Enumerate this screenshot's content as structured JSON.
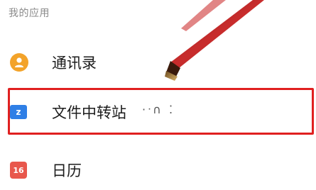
{
  "section": {
    "title": "我的应用"
  },
  "apps": [
    {
      "label": "通讯录",
      "icon": "contacts-icon",
      "icon_color": "#f3a32a"
    },
    {
      "label": "文件中转站",
      "icon": "file-transfer-icon",
      "icon_color": "#2f7fe6",
      "icon_text": "z"
    },
    {
      "label": "日历",
      "icon": "calendar-icon",
      "icon_color": "#e8574c",
      "icon_text": "16"
    }
  ],
  "annotation": {
    "highlight_color": "#e02020",
    "brush_color": "#b01818",
    "scribble": "·ᐧ∩ ⁚"
  }
}
